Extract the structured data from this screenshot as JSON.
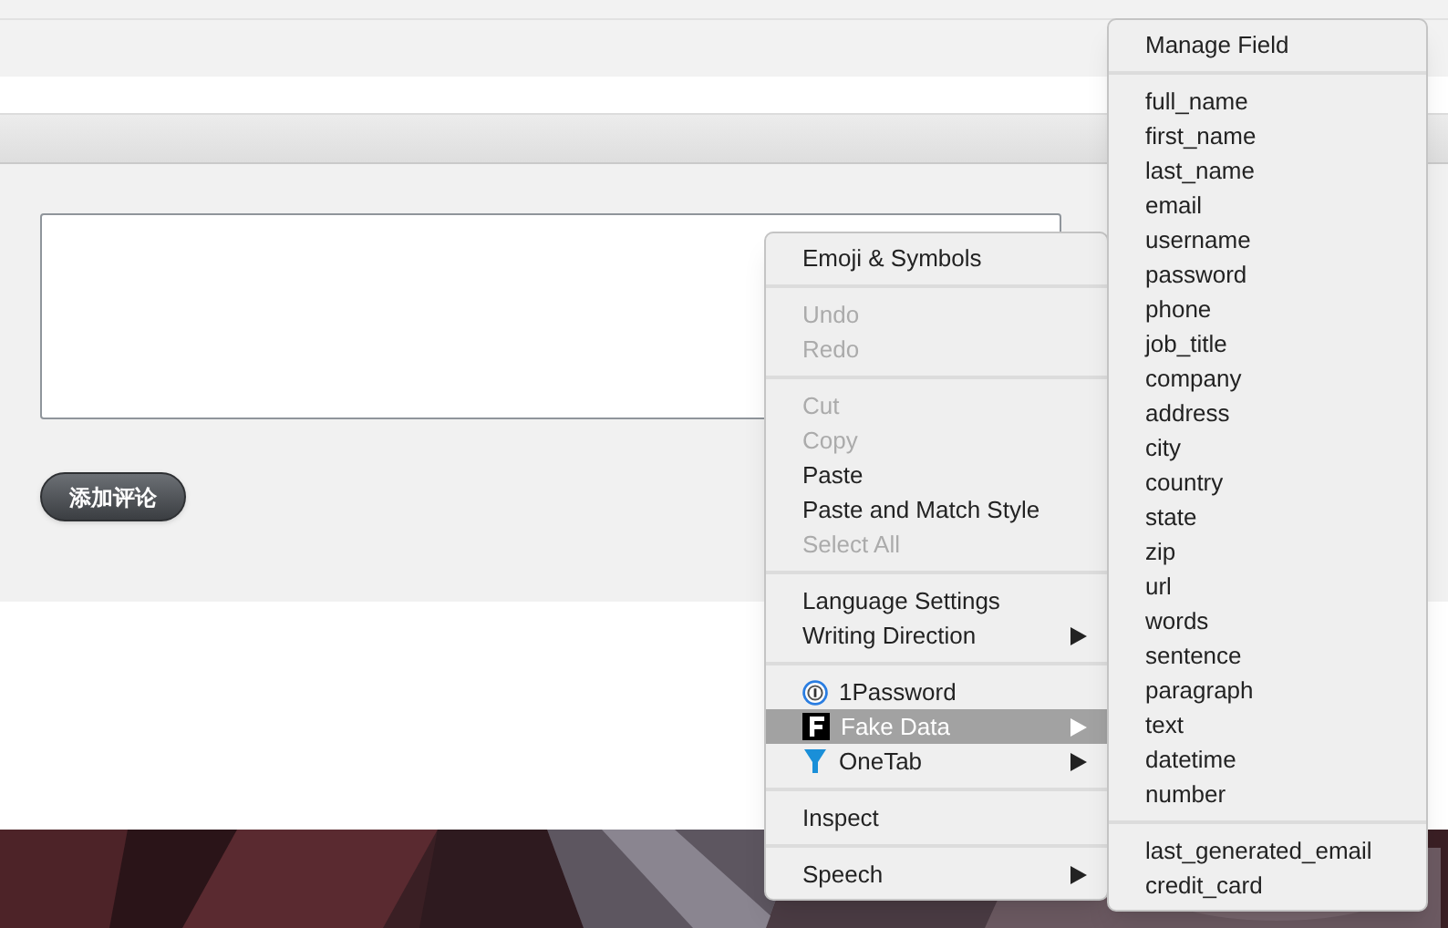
{
  "comment_form": {
    "button": "添加评论"
  },
  "context_menu": {
    "sections": [
      [
        {
          "label": "Emoji & Symbols",
          "disabled": false,
          "selected": false,
          "has_submenu": false,
          "kind": "plain"
        }
      ],
      [
        {
          "label": "Undo",
          "disabled": true,
          "selected": false,
          "has_submenu": false,
          "kind": "plain"
        },
        {
          "label": "Redo",
          "disabled": true,
          "selected": false,
          "has_submenu": false,
          "kind": "plain"
        }
      ],
      [
        {
          "label": "Cut",
          "disabled": true,
          "selected": false,
          "has_submenu": false,
          "kind": "plain"
        },
        {
          "label": "Copy",
          "disabled": true,
          "selected": false,
          "has_submenu": false,
          "kind": "plain"
        },
        {
          "label": "Paste",
          "disabled": false,
          "selected": false,
          "has_submenu": false,
          "kind": "plain"
        },
        {
          "label": "Paste and Match Style",
          "disabled": false,
          "selected": false,
          "has_submenu": false,
          "kind": "plain"
        },
        {
          "label": "Select All",
          "disabled": true,
          "selected": false,
          "has_submenu": false,
          "kind": "plain"
        }
      ],
      [
        {
          "label": "Language Settings",
          "disabled": false,
          "selected": false,
          "has_submenu": false,
          "kind": "plain"
        },
        {
          "label": "Writing Direction",
          "disabled": false,
          "selected": false,
          "has_submenu": true,
          "kind": "plain"
        }
      ],
      [
        {
          "label": "1Password",
          "disabled": false,
          "selected": false,
          "has_submenu": false,
          "kind": "keyhole"
        },
        {
          "label": "Fake Data",
          "disabled": false,
          "selected": true,
          "has_submenu": true,
          "kind": "letter"
        },
        {
          "label": "OneTab",
          "disabled": false,
          "selected": false,
          "has_submenu": true,
          "kind": "funnel"
        }
      ],
      [
        {
          "label": "Inspect",
          "disabled": false,
          "selected": false,
          "has_submenu": false,
          "kind": "plain"
        }
      ],
      [
        {
          "label": "Speech",
          "disabled": false,
          "selected": false,
          "has_submenu": true,
          "kind": "plain"
        }
      ]
    ]
  },
  "submenu": {
    "sections": [
      [
        "Manage Field"
      ],
      [
        "full_name",
        "first_name",
        "last_name",
        "email",
        "username",
        "password",
        "phone",
        "job_title",
        "company",
        "address",
        "city",
        "country",
        "state",
        "zip",
        "url",
        "words",
        "sentence",
        "paragraph",
        "text",
        "datetime",
        "number"
      ],
      [
        "last_generated_email",
        "credit_card"
      ]
    ]
  }
}
